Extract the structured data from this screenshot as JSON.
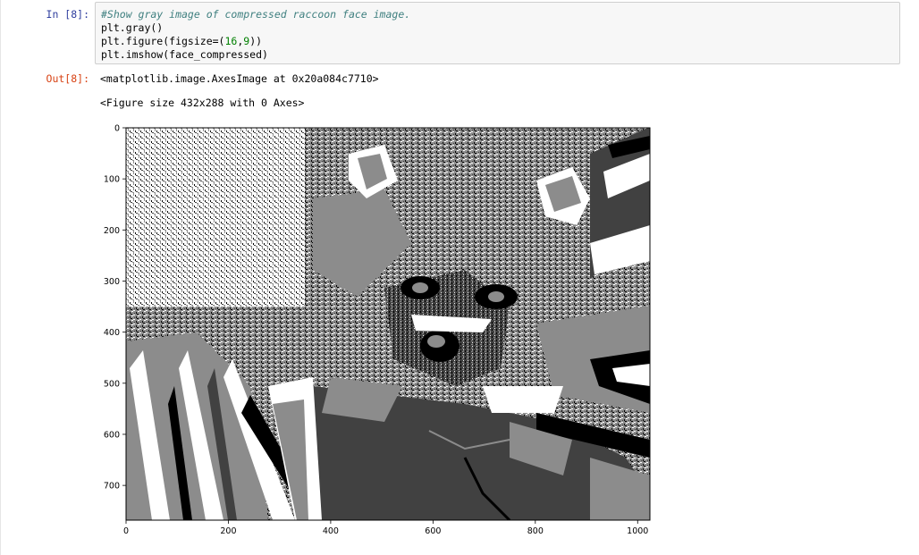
{
  "cell": {
    "in_prompt": "In [8]:",
    "out_prompt": "Out[8]:",
    "code": {
      "comment": "#Show gray image of compressed raccoon face image.",
      "line2": "plt.gray()",
      "line3_prefix": "plt.figure(figsize=(",
      "line3_num1": "16",
      "line3_comma": ",",
      "line3_num2": "9",
      "line3_suffix": "))",
      "line4": "plt.imshow(face_compressed)"
    },
    "outputs": {
      "repr": "<matplotlib.image.AxesImage at 0x20a084c7710>",
      "figure_repr": "<Figure size 432x288 with 0 Axes>"
    }
  },
  "plot": {
    "y_ticks": [
      "0",
      "100",
      "200",
      "300",
      "400",
      "500",
      "600",
      "700"
    ],
    "x_ticks": [
      "0",
      "200",
      "400",
      "600",
      "800",
      "1000"
    ],
    "colors": {
      "black": "#000000",
      "dark": "#414141",
      "mid": "#8c8c8c",
      "white": "#ffffff"
    }
  }
}
